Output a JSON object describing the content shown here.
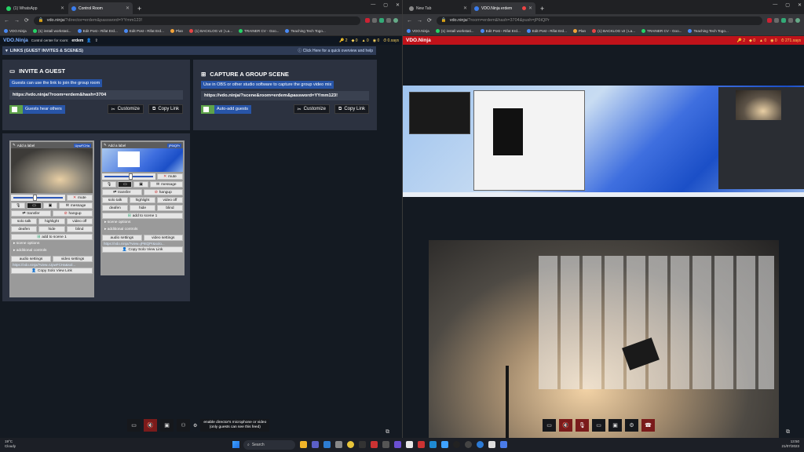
{
  "left": {
    "tabs": [
      {
        "label": "(1) WhatsApp",
        "active": false
      },
      {
        "label": "Control Room",
        "active": true
      }
    ],
    "url": {
      "host": "vdo.ninja",
      "path": "/?director=erdem&password=YYmm123!"
    },
    "bookmarks": [
      "VDO.Ninja",
      "(1) install workstati...",
      "Edit Post ‹ Rifat Erd...",
      "Edit Post ‹ Rifat Erd...",
      "Plan",
      "(1) BACKLOG v2 | La...",
      "TRAINER CV - Goo...",
      "Teaching Tech Togo..."
    ],
    "vdobar": {
      "brand": "VDO.Ninja",
      "sub": "Control center for room:",
      "room": "erdem",
      "stats": [
        "2",
        "0",
        "0",
        "0",
        "0.xays"
      ]
    },
    "links": {
      "title": "LINKS (GUEST INVITES & SCENES)",
      "help": "Click Here for a quick overview and help"
    },
    "invite": {
      "title": "INVITE A GUEST",
      "desc": "Guests can use the link to join the group room",
      "link": "https://vdo.ninja/?room=erdem&hash=3704",
      "toggle": "Guests hear others",
      "customize": "Customize",
      "copy": "Copy Link"
    },
    "capture": {
      "title": "CAPTURE A GROUP SCENE",
      "desc": "Use in OBS or other studio software to capture the group video mix",
      "link": "https://vdo.ninja/?scene&room=erdem&password=YYmm123!",
      "toggle": "Auto-add guests",
      "customize": "Customize",
      "copy": "Copy Link"
    },
    "guest1": {
      "label": "Add a label",
      "tag": "UpwFCHa",
      "mute": "mute",
      "message": "message",
      "transfer": "transfer",
      "hangup": "hangup",
      "solo": "solo talk",
      "highlight": "highlight",
      "videooff": "video off",
      "deafen": "deafen",
      "hide": "hide",
      "blind": "blind",
      "scene": "add to scene 1",
      "sceneopts": "scene options",
      "addl": "additional controls",
      "audio": "audio settings",
      "video": "video settings",
      "viewlink": "https://vdo.ninja/?view=UpwFCHa&sol...",
      "copysolo": "Copy Solo View Link"
    },
    "guest2": {
      "label": "Add a label",
      "tag": "jP6tQPr",
      "mute": "mute",
      "message": "message",
      "transfer": "transfer",
      "hangup": "hangup",
      "solo": "solo talk",
      "highlight": "highlight",
      "videooff": "video off",
      "deafen": "deafen",
      "hide": "hide",
      "blind": "blind",
      "scene": "add to scene 1",
      "sceneopts": "scene options",
      "addl": "additional controls",
      "audio": "audio settings",
      "video": "video settings",
      "viewlink": "https://vdo.ninja/?view=jP6tQPr&solo...",
      "copysolo": "Copy Solo View Link"
    },
    "hint": "enable director's microphone or video\n(only guests can see this feed)"
  },
  "right": {
    "tabs": [
      {
        "label": "New Tab",
        "active": false
      },
      {
        "label": "VDO.Ninja erdem",
        "active": true
      }
    ],
    "url": {
      "host": "vdo.ninja",
      "path": "/?room=erdem&hash=3704&push=jP6tQPr"
    },
    "bookmarks": [
      "VDO.Ninja",
      "(1) install workstati...",
      "Edit Post ‹ Rifat Erd...",
      "Edit Post ‹ Rifat Erd...",
      "Plan",
      "(1) BACKLOG v2 | La...",
      "TRAINER CV - Goo...",
      "Teaching Tech Togo..."
    ],
    "vdobar": {
      "brand": "VDO.Ninja",
      "stats": [
        "2",
        "0",
        "0",
        "0",
        "271.xays"
      ]
    }
  },
  "taskbar": {
    "temp": "19°C",
    "cond": "Cloudy",
    "search": "Search",
    "time": "13:50",
    "date": "21/07/2023"
  },
  "colors": {
    "accent": "#2855a8",
    "green": "#5ea34a",
    "red_bar": "#c0121a"
  }
}
